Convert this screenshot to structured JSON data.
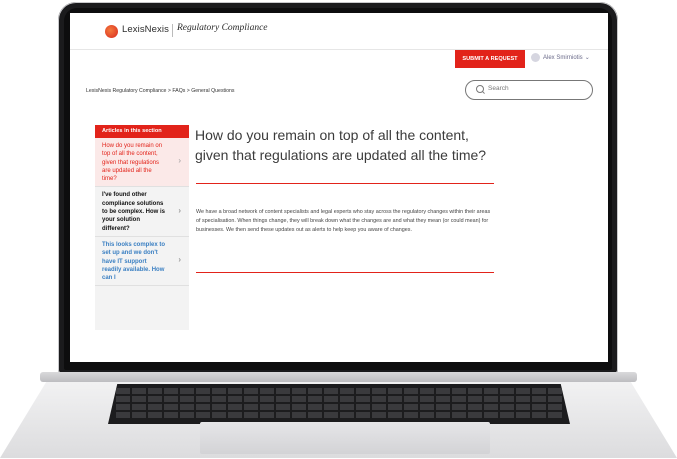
{
  "header": {
    "brand": "LexisNexis",
    "product": "Regulatory Compliance",
    "submit_label": "SUBMIT A REQUEST",
    "user_name": "Alex Smirniotis",
    "user_caret": "⌄"
  },
  "breadcrumb": "LexisNexis Regulatory Compliance > FAQs > General Questions",
  "search": {
    "placeholder": "Search"
  },
  "sidebar": {
    "heading": "Articles in this section",
    "items": [
      {
        "label": "How do you remain on top of all the content, given that regulations are updated all the time?"
      },
      {
        "label": "I've found other compliance solutions to be complex. How is your solution different?"
      },
      {
        "label": "This looks complex to set up and we don't have IT support readily available. How can I"
      }
    ],
    "chevron": "›"
  },
  "article": {
    "title": "How do you remain on top of all the content, given that regulations are updated all the time?",
    "body": "We have a broad network of content specialists and legal experts who stay across the regulatory changes within their areas of specialisation. When things change, they will break down what the changes are and what they mean (or could mean) for businesses. We then send these updates out as alerts to help keep you aware of changes."
  },
  "colors": {
    "accent": "#e2231a",
    "link": "#3a7fc2"
  }
}
